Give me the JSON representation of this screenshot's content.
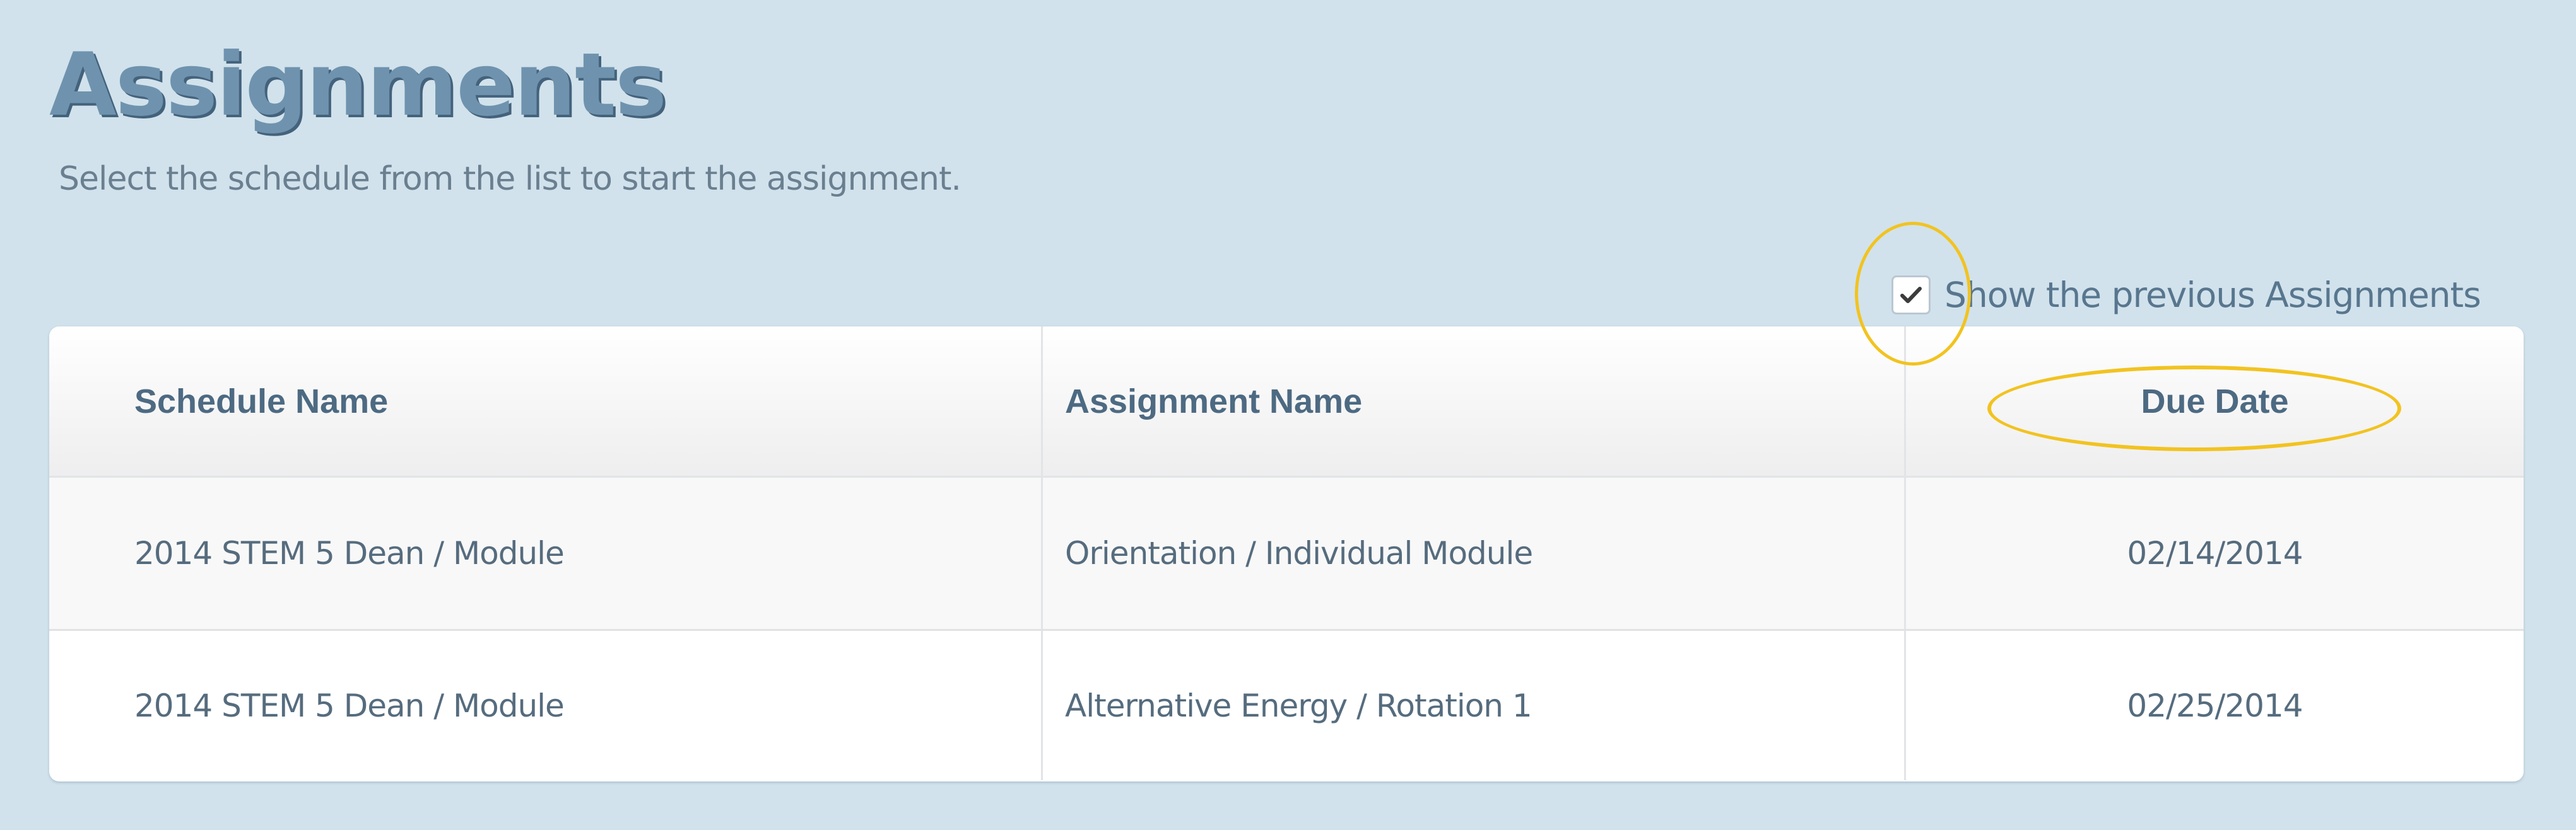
{
  "page": {
    "title": "Assignments",
    "subtitle": "Select the schedule from the list to start the assignment."
  },
  "toggle": {
    "label": "Show the previous Assignments",
    "checked": true
  },
  "table": {
    "columns": [
      "Schedule Name",
      "Assignment Name",
      "Due Date"
    ],
    "rows": [
      {
        "schedule_name": "2014 STEM 5 Dean / Module",
        "assignment_name": "Orientation / Individual Module",
        "due_date": "02/14/2014"
      },
      {
        "schedule_name": "2014 STEM 5 Dean / Module",
        "assignment_name": "Alternative Energy / Rotation 1",
        "due_date": "02/25/2014"
      }
    ]
  },
  "icons": {
    "checkbox": "checkmark-icon"
  },
  "colors": {
    "background": "#d1e2ec",
    "title": "#6f93ae",
    "header_text": "#4d6a82",
    "highlight": "#f2c320"
  }
}
